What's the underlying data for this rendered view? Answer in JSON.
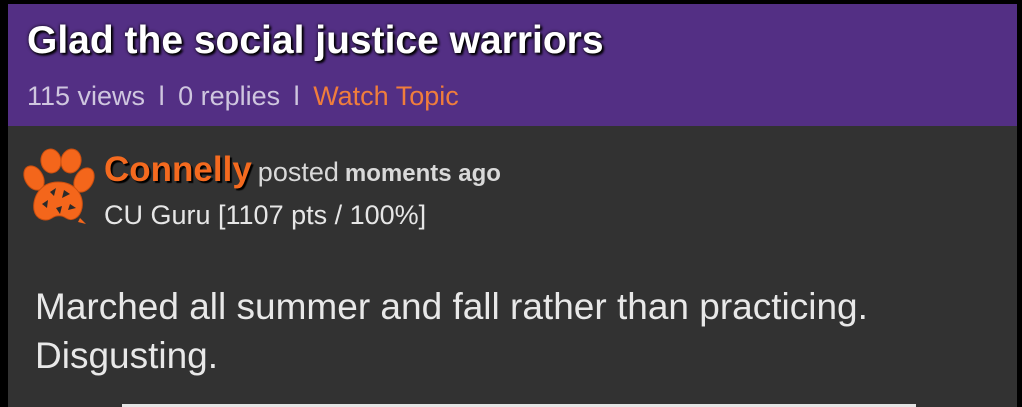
{
  "topic": {
    "title": "Glad the social justice warriors",
    "views": "115 views",
    "separator": "l",
    "replies": "0 replies",
    "watch_label": "Watch Topic"
  },
  "post": {
    "author": "Connelly",
    "posted_label": "posted",
    "time": "moments ago",
    "rank": "CU Guru [1107 pts / 100%]",
    "avatar_icon": "tiger-paw-icon",
    "text": "Marched all summer and fall rather than practicing. Disgusting."
  },
  "colors": {
    "header_bg": "#532f84",
    "body_bg": "#323232",
    "accent_orange": "#f46a1f",
    "link_orange": "#f07d3c"
  }
}
